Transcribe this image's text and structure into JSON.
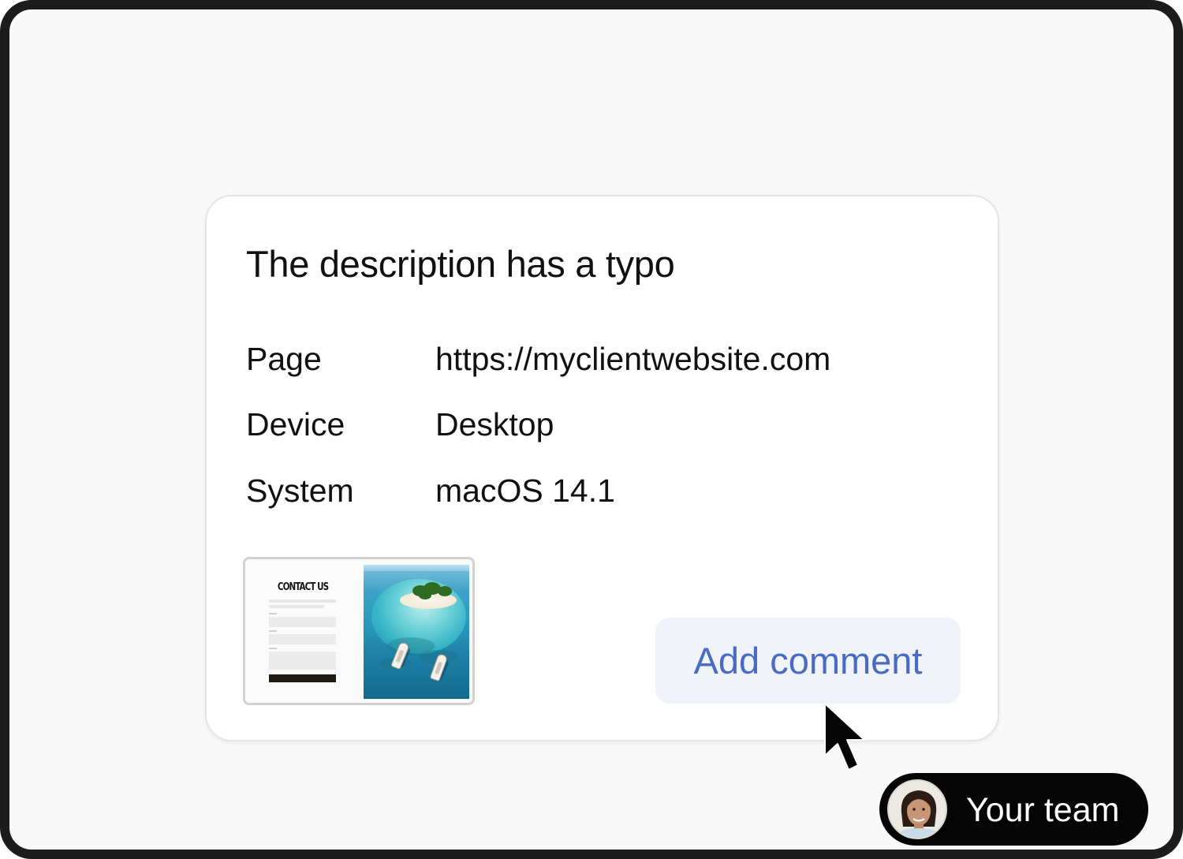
{
  "card": {
    "title": "The description has a typo",
    "meta": {
      "page_label": "Page",
      "page_value": "https://myclientwebsite.com",
      "device_label": "Device",
      "device_value": "Desktop",
      "system_label": "System",
      "system_value": "macOS 14.1"
    },
    "screenshot_thumbnail": {
      "heading": "CONTACT US"
    },
    "add_comment_label": "Add comment"
  },
  "team_badge": {
    "label": "Your team",
    "avatar_icon": "person-avatar"
  },
  "colors": {
    "accent_text": "#4a6bc4",
    "button_bg": "#f1f3fa",
    "frame_border": "#1c1c1c",
    "badge_bg": "#050505"
  }
}
